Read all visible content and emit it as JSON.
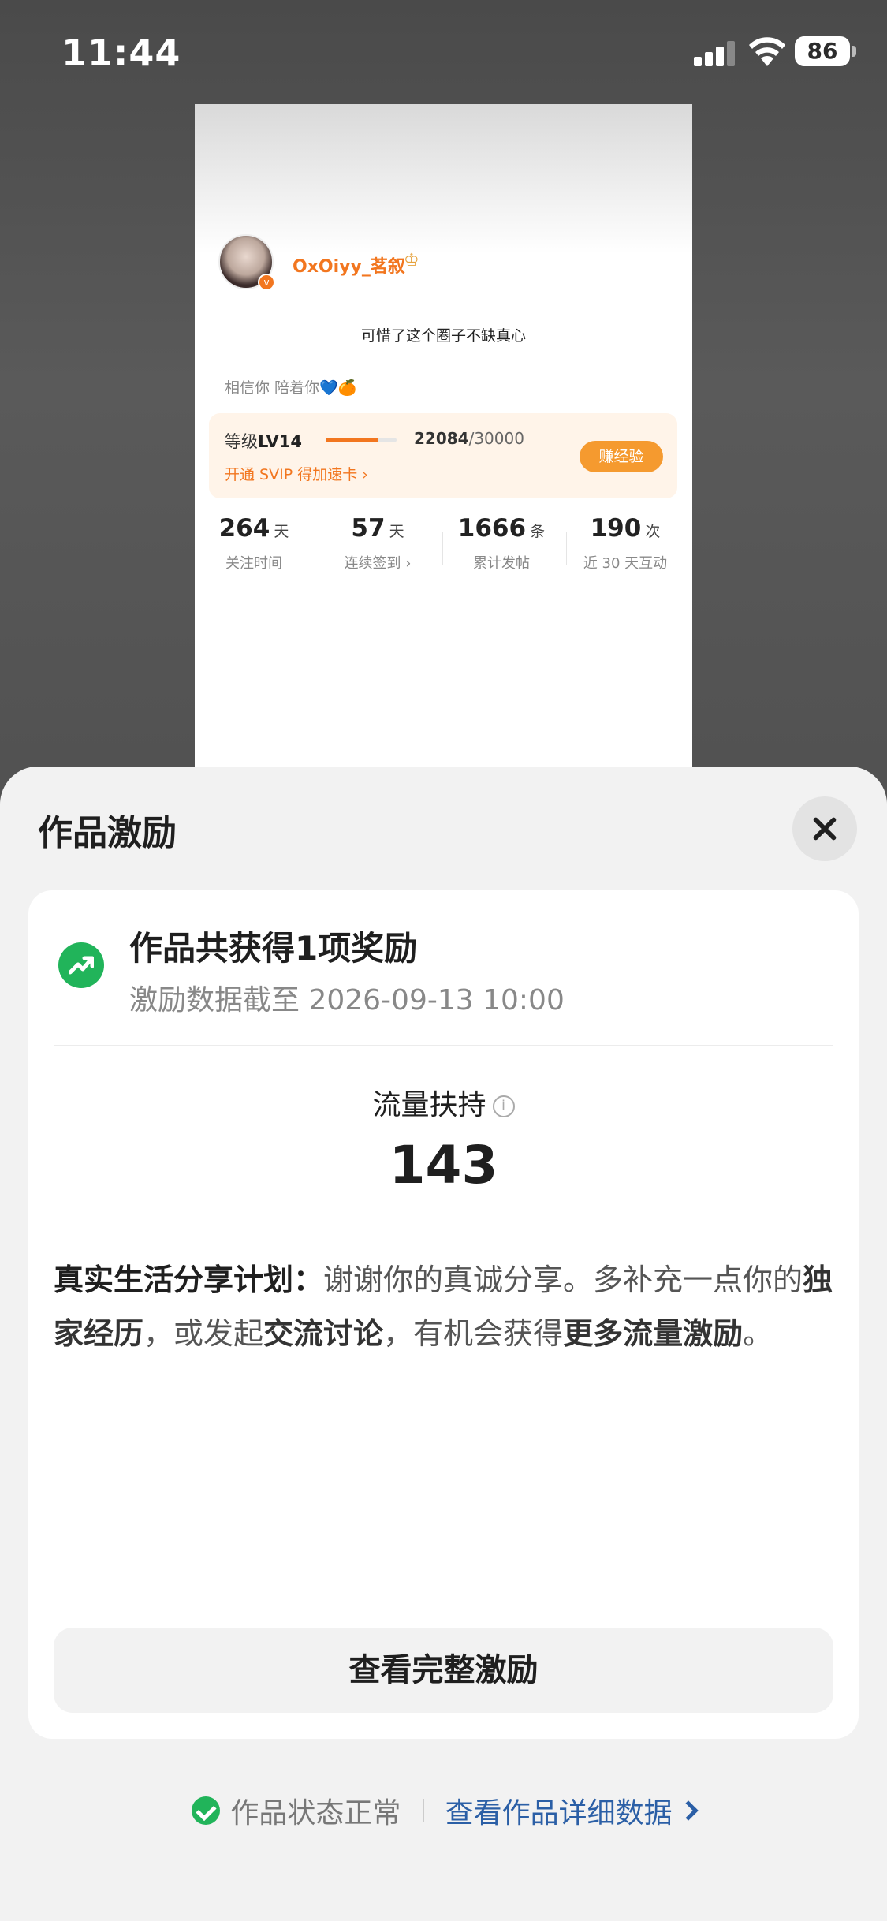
{
  "status_bar": {
    "time": "11:44",
    "battery": "86"
  },
  "preview": {
    "username": "OxOiyy_茗叙",
    "bio": "可惜了这个圈子不缺真心",
    "motto": "相信你 陪着你💙🍊",
    "level": {
      "label": "等级",
      "level": "LV14",
      "current": "22084",
      "total": "/30000",
      "progress_fraction": 0.74,
      "svip": "开通 SVIP 得加速卡 ›",
      "earn_button": "赚经验"
    },
    "stats": [
      {
        "value": "264",
        "unit": "天",
        "label": "关注时间"
      },
      {
        "value": "57",
        "unit": "天",
        "label": "连续签到 ›"
      },
      {
        "value": "1666",
        "unit": "条",
        "label": "累计发帖"
      },
      {
        "value": "190",
        "unit": "次",
        "label": "近 30 天互动"
      }
    ]
  },
  "sheet": {
    "title": "作品激励",
    "card": {
      "heading": "作品共获得1项奖励",
      "subheading": "激励数据截至 2026-09-13 10:00",
      "metric_label": "流量扶持",
      "metric_value": "143",
      "desc": {
        "plan": "真实生活分享计划：",
        "p1": "谢谢你的真诚分享。多补充一点你的",
        "b1": "独家经历",
        "p2": "，或发起",
        "b2": "交流讨论",
        "p3": "，有机会获得",
        "b3": "更多流量激励",
        "p4": "。"
      },
      "button": "查看完整激励"
    },
    "footer": {
      "status": "作品状态正常",
      "link": "查看作品详细数据"
    }
  }
}
